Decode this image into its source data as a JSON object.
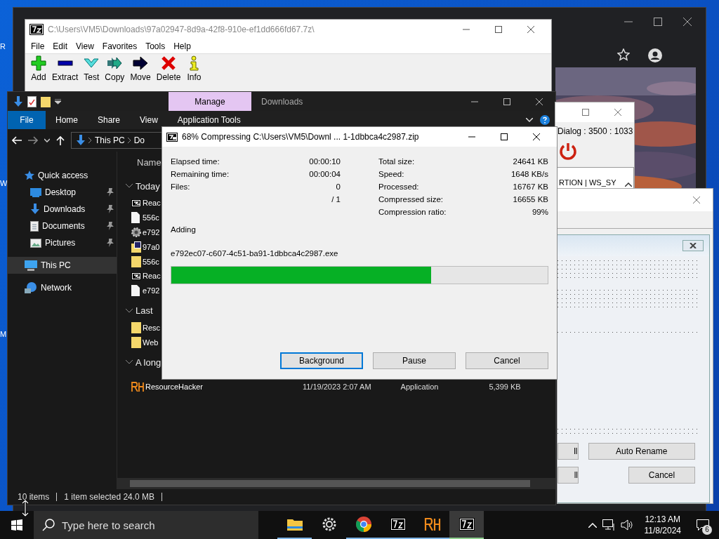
{
  "desktop": {
    "icon_labels": [
      "R",
      "W",
      "M"
    ]
  },
  "archive_manager": {
    "title": "C:\\Users\\VM5\\Downloads\\97a02947-8d9a-42f8-910e-ef1dd666fd67.7z\\",
    "menu": [
      "File",
      "Edit",
      "View",
      "Favorites",
      "Tools",
      "Help"
    ],
    "toolbar": [
      {
        "label": "Add",
        "kind": "add"
      },
      {
        "label": "Extract",
        "kind": "extract"
      },
      {
        "label": "Test",
        "kind": "test"
      },
      {
        "label": "Copy",
        "kind": "copy"
      },
      {
        "label": "Move",
        "kind": "move"
      },
      {
        "label": "Delete",
        "kind": "delete"
      },
      {
        "label": "Info",
        "kind": "info"
      }
    ]
  },
  "explorer": {
    "context_tab": "Manage",
    "title": "Downloads",
    "ribbon_tabs": [
      {
        "label": "File",
        "kind": "file"
      },
      {
        "label": "Home",
        "kind": "tab"
      },
      {
        "label": "Share",
        "kind": "tab"
      },
      {
        "label": "View",
        "kind": "tab"
      },
      {
        "label": "Application Tools",
        "kind": "tab"
      }
    ],
    "address": [
      "This PC",
      "Do"
    ],
    "sidebar": [
      {
        "label": "Quick access",
        "kind": "star",
        "selected": false,
        "children": [
          {
            "label": "Desktop",
            "kind": "desktop",
            "pinned": true,
            "selected": false
          },
          {
            "label": "Downloads",
            "kind": "download",
            "pinned": true,
            "selected": false
          },
          {
            "label": "Documents",
            "kind": "document",
            "pinned": true,
            "selected": false
          },
          {
            "label": "Pictures",
            "kind": "pictures",
            "pinned": true,
            "selected": false
          }
        ]
      },
      {
        "label": "This PC",
        "kind": "pc",
        "selected": true
      },
      {
        "label": "Network",
        "kind": "network",
        "selected": false
      }
    ],
    "column": "Name",
    "groups": [
      {
        "label": "Today",
        "rows": [
          {
            "name": "Reac",
            "kind": "sevenzip"
          },
          {
            "name": "556c",
            "kind": "file"
          },
          {
            "name": "e792",
            "kind": "gear"
          },
          {
            "name": "97a0",
            "kind": "archive"
          },
          {
            "name": "556c",
            "kind": "folder"
          },
          {
            "name": "Reac",
            "kind": "sevenzip"
          },
          {
            "name": "e792",
            "kind": "file"
          }
        ]
      },
      {
        "label": "Last",
        "rows": [
          {
            "name": "Resc",
            "kind": "folder"
          },
          {
            "name": "Web",
            "kind": "folder"
          }
        ]
      },
      {
        "label": "A long",
        "rows": [
          {
            "name": "ResourceHacker",
            "kind": "rh",
            "date": "11/19/2023 2:07 AM",
            "type": "Application",
            "size": "5,399 KB"
          }
        ]
      }
    ],
    "status": {
      "count": "10 items",
      "selection": "1 item selected  24.0 MB"
    }
  },
  "resource_window": {
    "title": "Dialog : 3500 : 1033",
    "list_text": "RTION | WS_SY"
  },
  "rename_dialog": {
    "buttons": [
      {
        "label": "ll",
        "kind": "cut"
      },
      {
        "label": "Auto Rename",
        "kind": "wide"
      },
      {
        "label": "ll",
        "kind": "cut"
      },
      {
        "label": "Cancel",
        "kind": "right"
      }
    ]
  },
  "progress_dialog": {
    "title": "68% Compressing C:\\Users\\VM5\\Downl ... 1-1dbbca4c2987.zip",
    "left_stats": [
      {
        "label": "Elapsed time:",
        "value": "00:00:10"
      },
      {
        "label": "Remaining time:",
        "value": "00:00:04"
      },
      {
        "label": "Files:",
        "value": "0"
      },
      {
        "value": "/ 1"
      }
    ],
    "right_stats": [
      {
        "label": "Total size:",
        "value": "24641 KB"
      },
      {
        "label": "Speed:",
        "value": "1648 KB/s"
      },
      {
        "label": "Processed:",
        "value": "16767 KB"
      },
      {
        "label": "Compressed size:",
        "value": "16655 KB"
      },
      {
        "label": "Compression ratio:",
        "value": "99%"
      }
    ],
    "operation": "Adding",
    "file": "e792ec07-c607-4c51-ba91-1dbbca4c2987.exe",
    "level": 0.69,
    "buttons": [
      {
        "label": "Background",
        "selected": true
      },
      {
        "label": "Pause",
        "selected": false
      },
      {
        "label": "Cancel",
        "selected": false
      }
    ]
  },
  "taskbar": {
    "search": {
      "placeholder": "Type here to search"
    },
    "apps": [
      {
        "kind": "explorer",
        "running": true,
        "active": false
      },
      {
        "kind": "settings",
        "running": false,
        "active": false
      },
      {
        "kind": "chrome",
        "running": true,
        "active": false
      },
      {
        "kind": "sevenzip",
        "running": true,
        "active": false
      },
      {
        "kind": "rh",
        "running": true,
        "active": false
      },
      {
        "kind": "sevenzip",
        "running": true,
        "active": true
      }
    ],
    "time": "12:13 AM",
    "date": "11/8/2024",
    "notifications": "6"
  }
}
